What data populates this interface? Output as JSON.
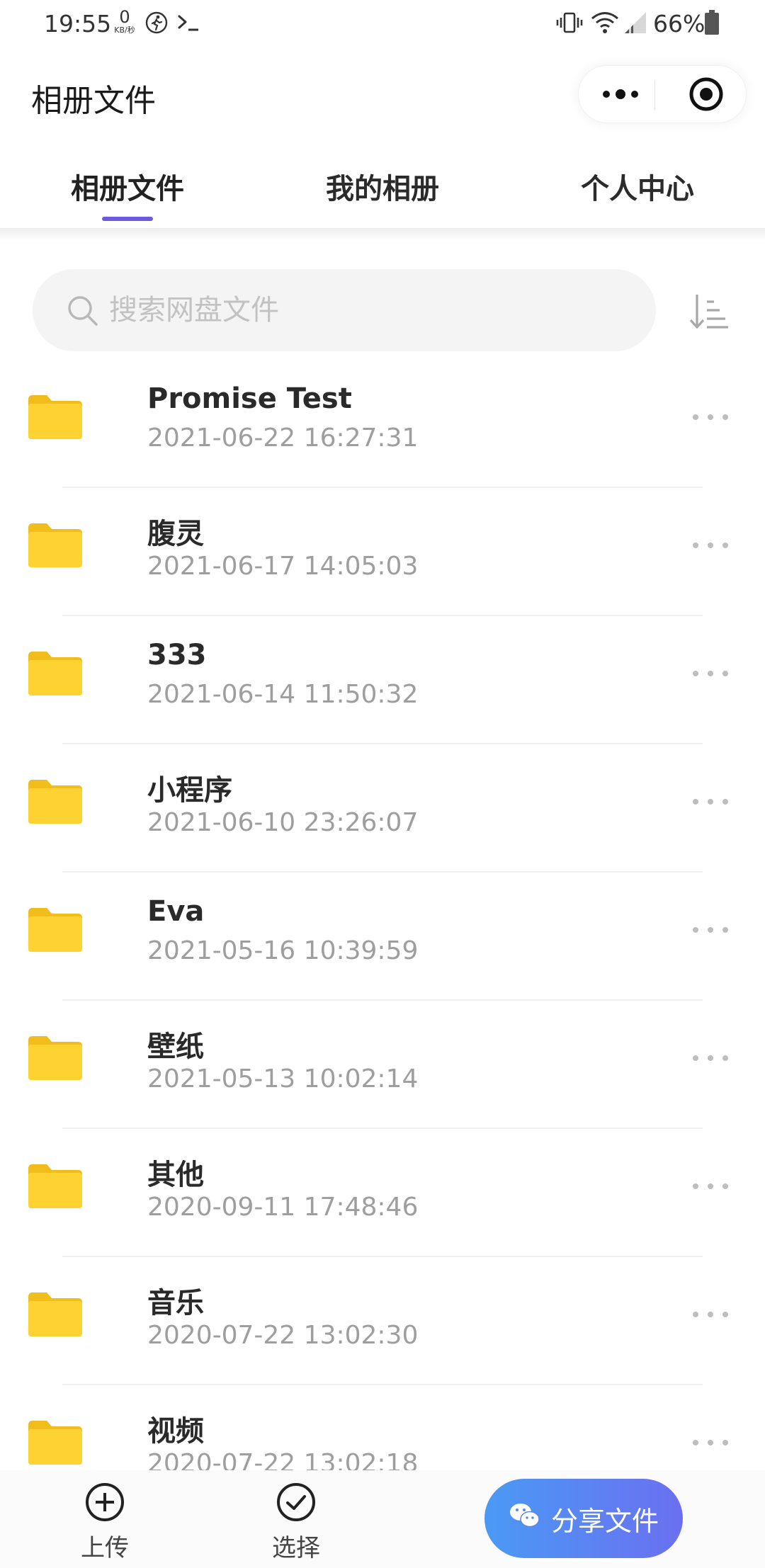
{
  "status_bar": {
    "time": "19:55",
    "net_speed_value": "0",
    "net_speed_unit": "KB/秒",
    "battery_text": "66%"
  },
  "header": {
    "title": "相册文件"
  },
  "tabs": [
    {
      "label": "相册文件",
      "active": true
    },
    {
      "label": "我的相册",
      "active": false
    },
    {
      "label": "个人中心",
      "active": false
    }
  ],
  "search": {
    "placeholder": "搜索网盘文件"
  },
  "files": [
    {
      "name": "Promise Test",
      "date": "2021-06-22 16:27:31"
    },
    {
      "name": "腹灵",
      "date": "2021-06-17 14:05:03"
    },
    {
      "name": "333",
      "date": "2021-06-14 11:50:32"
    },
    {
      "name": "小程序",
      "date": "2021-06-10 23:26:07"
    },
    {
      "name": "Eva",
      "date": "2021-05-16 10:39:59"
    },
    {
      "name": "壁纸",
      "date": "2021-05-13 10:02:14"
    },
    {
      "name": "其他",
      "date": "2020-09-11 17:48:46"
    },
    {
      "name": "音乐",
      "date": "2020-07-22 13:02:30"
    },
    {
      "name": "视频",
      "date": "2020-07-22 13:02:18"
    }
  ],
  "bottom_bar": {
    "upload_label": "上传",
    "select_label": "选择",
    "share_label": "分享文件"
  },
  "colors": {
    "accent": "#6a5ae0",
    "folder": "#ffd233",
    "share_gradient_start": "#4a9af5",
    "share_gradient_end": "#6b6ff0"
  }
}
